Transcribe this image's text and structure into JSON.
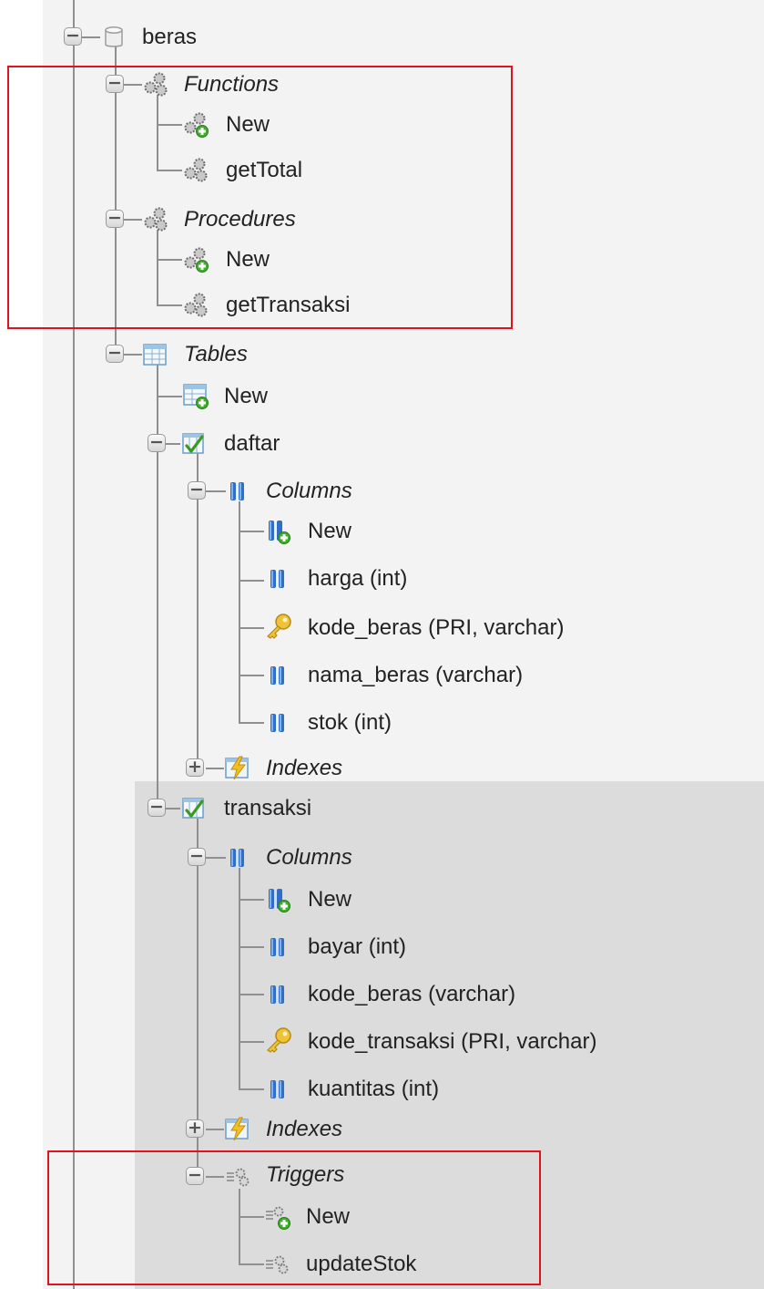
{
  "tree": {
    "db": {
      "label": "beras",
      "toggle": "−",
      "icon": "database-icon"
    },
    "functions": {
      "label": "Functions",
      "toggle": "−",
      "icon": "gear-cluster-icon",
      "items": [
        {
          "label": "New",
          "icon": "gear-new-icon"
        },
        {
          "label": "getTotal",
          "icon": "gear-cluster-icon"
        }
      ]
    },
    "procedures": {
      "label": "Procedures",
      "toggle": "−",
      "icon": "gear-cluster-icon",
      "items": [
        {
          "label": "New",
          "icon": "gear-new-icon"
        },
        {
          "label": "getTransaksi",
          "icon": "gear-cluster-icon"
        }
      ]
    },
    "tables": {
      "label": "Tables",
      "toggle": "−",
      "icon": "table-icon",
      "new_label": "New",
      "daftar": {
        "label": "daftar",
        "toggle": "−",
        "icon": "table-check-icon",
        "columns_label": "Columns",
        "columns": [
          {
            "label": "New",
            "icon": "column-new-icon"
          },
          {
            "label": "harga (int)",
            "icon": "column-icon"
          },
          {
            "label": "kode_beras (PRI, varchar)",
            "icon": "key-icon"
          },
          {
            "label": "nama_beras (varchar)",
            "icon": "column-icon"
          },
          {
            "label": "stok (int)",
            "icon": "column-icon"
          }
        ],
        "indexes_label": "Indexes",
        "indexes_toggle": "+"
      },
      "transaksi": {
        "label": "transaksi",
        "toggle": "−",
        "icon": "table-check-icon",
        "columns_label": "Columns",
        "columns": [
          {
            "label": "New",
            "icon": "column-new-icon"
          },
          {
            "label": "bayar (int)",
            "icon": "column-icon"
          },
          {
            "label": "kode_beras (varchar)",
            "icon": "column-icon"
          },
          {
            "label": "kode_transaksi (PRI, varchar)",
            "icon": "key-icon"
          },
          {
            "label": "kuantitas (int)",
            "icon": "column-icon"
          }
        ],
        "indexes_label": "Indexes",
        "indexes_toggle": "+",
        "triggers": {
          "label": "Triggers",
          "toggle": "−",
          "icon": "trigger-icon",
          "items": [
            {
              "label": "New",
              "icon": "trigger-new-icon"
            },
            {
              "label": "updateStok",
              "icon": "trigger-icon"
            }
          ]
        }
      }
    }
  },
  "colors": {
    "highlight_box": "#e0141e",
    "selected_background": "#dcdcdc",
    "tree_line": "#8f8f8f"
  }
}
